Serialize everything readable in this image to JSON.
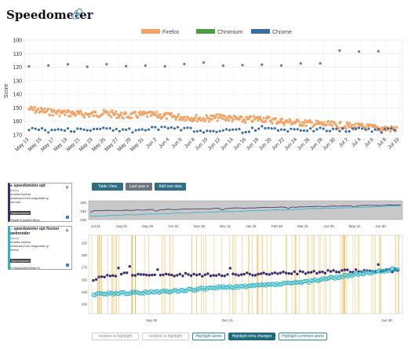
{
  "page": {
    "title": "Speedometer"
  },
  "icons": {
    "link": "link-icon",
    "sort": "arrow-down-icon"
  },
  "legend": [
    {
      "label": "Firefox",
      "color": "#f4a263"
    },
    {
      "label": "Chromium",
      "color": "#4a9c3d"
    },
    {
      "label": "Chrome",
      "color": "#3b6ea5"
    }
  ],
  "chart_data": [
    {
      "type": "scatter",
      "ylabel": "Score",
      "ylim": [
        170,
        100
      ],
      "y_inverted": true,
      "y_ticks": [
        100,
        110,
        120,
        130,
        140,
        150,
        160,
        170
      ],
      "x_ticks": [
        "May 13",
        "May 15",
        "May 17",
        "May 19",
        "May 21",
        "May 23",
        "May 25",
        "May 27",
        "May 29",
        "May 31",
        "Jun 2",
        "Jun 4",
        "Jun 6",
        "Jun 8",
        "Jun 10",
        "Jun 12",
        "Jun 14",
        "Jun 16",
        "Jun 18",
        "Jun 20",
        "Jun 22",
        "Jun 24",
        "Jun 26",
        "Jun 28",
        "Jun 30",
        "Jul 2",
        "Jul 4",
        "Jul 6",
        "Jul 8",
        "Jul 10"
      ],
      "grid": true,
      "legend_position": "top-center",
      "series": [
        {
          "name": "Firefox",
          "color": "#f4a263",
          "x": [
            0,
            3,
            6,
            9,
            12,
            15,
            18,
            21,
            24,
            27,
            30,
            33,
            36,
            39,
            42,
            45,
            48,
            51,
            54,
            57
          ],
          "values": [
            151,
            153,
            154,
            155,
            154,
            156,
            155,
            156,
            157,
            158,
            157,
            159,
            158,
            160,
            161,
            162,
            163,
            164,
            165,
            166
          ]
        },
        {
          "name": "Chromium",
          "color": "#4a9c3d",
          "x": [
            0,
            3,
            6,
            9,
            12,
            15,
            18,
            21,
            24,
            27,
            30,
            33,
            36,
            39,
            42,
            45,
            48,
            51,
            54,
            57
          ],
          "values": [
            119,
            118,
            118,
            119,
            118,
            119,
            118,
            119,
            118,
            117,
            118,
            118,
            119,
            119,
            118,
            117,
            108,
            108,
            109,
            107
          ]
        },
        {
          "name": "Chrome",
          "color": "#3b6ea5",
          "x": [
            0,
            3,
            6,
            9,
            12,
            15,
            18,
            21,
            24,
            27,
            30,
            33,
            36,
            39,
            42,
            45,
            48,
            51,
            54,
            57
          ],
          "values": [
            165,
            167,
            166,
            167,
            165,
            167,
            166,
            165,
            166,
            167,
            166,
            167,
            165,
            167,
            166,
            166,
            167,
            165,
            167,
            166
          ]
        }
      ]
    },
    {
      "type": "scatter",
      "y_ticks": [
        100,
        150,
        200
      ],
      "x_ticks": [
        "Jul 31",
        "Aug 31",
        "Sep 30",
        "Oct 31",
        "Nov 30",
        "Dec 31",
        "Jan 31",
        "Feb 28",
        "Mar 31",
        "Apr 30",
        "May 31",
        "Jun 30"
      ],
      "series": [
        {
          "name": "speedometer opt",
          "color": "#3b2e6e",
          "x": [
            0,
            11
          ],
          "values": [
            150,
            185
          ]
        },
        {
          "name": "speedometer opt fission webrender",
          "color": "#2ab3c7",
          "x": [
            0,
            11
          ],
          "values": [
            120,
            180
          ]
        }
      ]
    },
    {
      "type": "scatter",
      "y_ticks": [
        100,
        125,
        150,
        175,
        200,
        225
      ],
      "x_ticks": [
        "Sep 30",
        "Dec 31",
        "Jun 30"
      ],
      "grid": true,
      "series": [
        {
          "name": "speedometer opt",
          "color": "#3b2e6e",
          "x": [
            0,
            1,
            2,
            3,
            4,
            5,
            6,
            7,
            8,
            9,
            10
          ],
          "values": [
            150,
            162,
            158,
            160,
            159,
            161,
            162,
            164,
            166,
            168,
            168
          ]
        },
        {
          "name": "speedometer opt fission webrender",
          "color": "#2ab3c7",
          "x": [
            0,
            1,
            2,
            3,
            4,
            5,
            6,
            7,
            8,
            9,
            10
          ],
          "values": [
            120,
            122,
            124,
            128,
            133,
            136,
            140,
            145,
            155,
            163,
            172
          ]
        }
      ]
    }
  ],
  "panels": [
    {
      "name": "speedometer opt",
      "lines": [
        "[devs]",
        "mozilla-central",
        "windows10-64-shippable-qr",
        "chrome"
      ],
      "tag": "Speedometer",
      "hash": "78adb7b3c8d876b4a"
    },
    {
      "name": "speedometer opt fission webrender",
      "lines": [
        "[devs]",
        "mozilla-central",
        "windows10-64-shippable-qr",
        "firefox"
      ],
      "tag": "Speedometer",
      "hash": "b796a3ad5b306de7b"
    }
  ],
  "toolbar": {
    "table_view": "Table View",
    "range": "Last year ▾",
    "add_test": "Add test data"
  },
  "filters": {
    "revision_placeholder_1": "revision to highlight",
    "revision_placeholder_2": "revision to highlight",
    "highlight_alerts": "Highlight alerts",
    "highlight_infra": "Highlight infra changes",
    "highlight_common": "Highlight common alerts"
  }
}
